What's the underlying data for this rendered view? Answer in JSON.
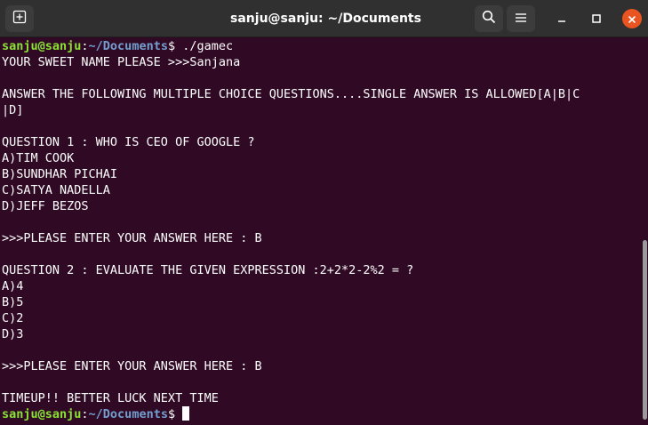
{
  "titlebar": {
    "title": "sanju@sanju: ~/Documents",
    "icons": {
      "new_tab": "new-tab-icon",
      "search": "search-icon",
      "menu": "hamburger-menu-icon",
      "minimize": "minimize-icon",
      "maximize": "maximize-icon",
      "close": "close-icon"
    },
    "colors": {
      "bar": "#303030",
      "close": "#e95420"
    }
  },
  "terminal": {
    "colors": {
      "background": "#300a24",
      "user": "#8ae234",
      "path": "#729fcf",
      "text": "#ffffff"
    },
    "prompt1": {
      "user": "sanju@sanju",
      "sep": ":",
      "path": "~/Documents",
      "symbol": "$",
      "command": " ./gamec"
    },
    "lines": [
      "YOUR SWEET NAME PLEASE >>>Sanjana",
      "",
      "ANSWER THE FOLLOWING MULTIPLE CHOICE QUESTIONS....SINGLE ANSWER IS ALLOWED[A|B|C",
      "|D]",
      "",
      "QUESTION 1 : WHO IS CEO OF GOOGLE ?",
      "A)TIM COOK",
      "B)SUNDHAR PICHAI",
      "C)SATYA NADELLA",
      "D)JEFF BEZOS",
      "",
      ">>>PLEASE ENTER YOUR ANSWER HERE : B",
      "",
      "QUESTION 2 : EVALUATE THE GIVEN EXPRESSION :2+2*2-2%2 = ?",
      "A)4",
      "B)5",
      "C)2",
      "D)3",
      "",
      ">>>PLEASE ENTER YOUR ANSWER HERE : B",
      "",
      "TIMEUP!! BETTER LUCK NEXT TIME"
    ],
    "prompt2": {
      "user": "sanju@sanju",
      "sep": ":",
      "path": "~/Documents",
      "symbol": "$",
      "command": " "
    }
  }
}
